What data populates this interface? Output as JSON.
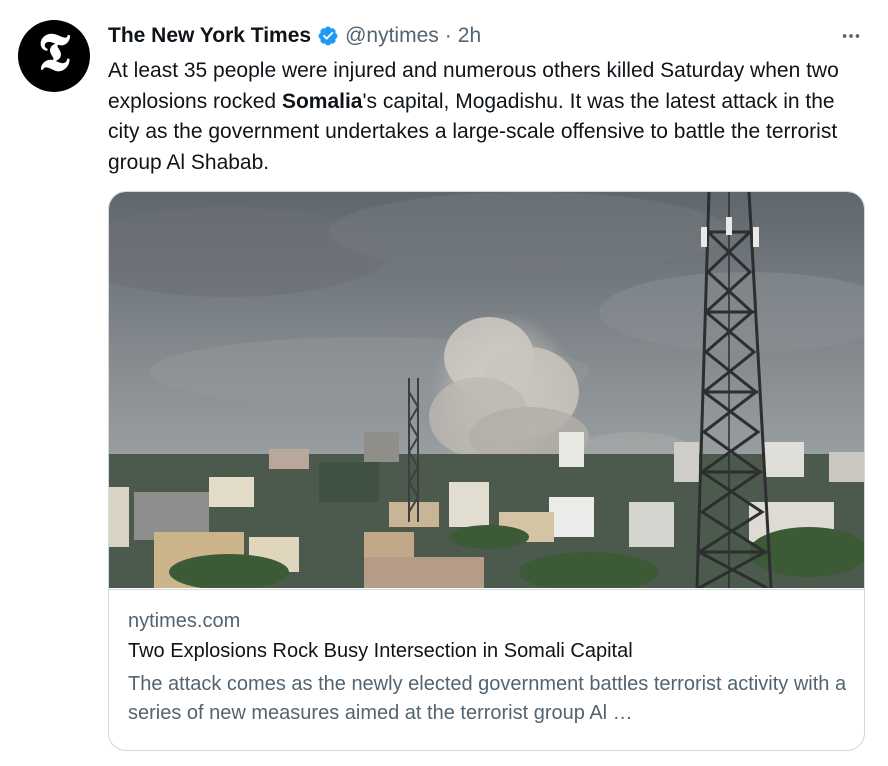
{
  "tweet": {
    "avatar_glyph": "𝕿",
    "author_name": "The New York Times",
    "handle": "@nytimes",
    "separator": "·",
    "time": "2h",
    "text_before": "At least 35 people were injured and numerous others killed Saturday when two explosions rocked ",
    "text_bold": "Somalia",
    "text_after": "'s capital, Mogadishu. It was the latest attack in the city as the government undertakes a large-scale offensive to battle the terrorist group Al Shabab.",
    "more_icon": "more-horizontal-icon",
    "verified_icon": "verified-badge-icon"
  },
  "card": {
    "domain": "nytimes.com",
    "title": "Two Explosions Rock Busy Intersection in Somali Capital",
    "description": "The attack comes as the newly elected government battles terrorist activity with a series of new measures aimed at the terrorist group Al …"
  },
  "colors": {
    "text_primary": "#0f1419",
    "text_secondary": "#536471",
    "verified_blue": "#1d9bf0",
    "border": "#cfd9de"
  }
}
